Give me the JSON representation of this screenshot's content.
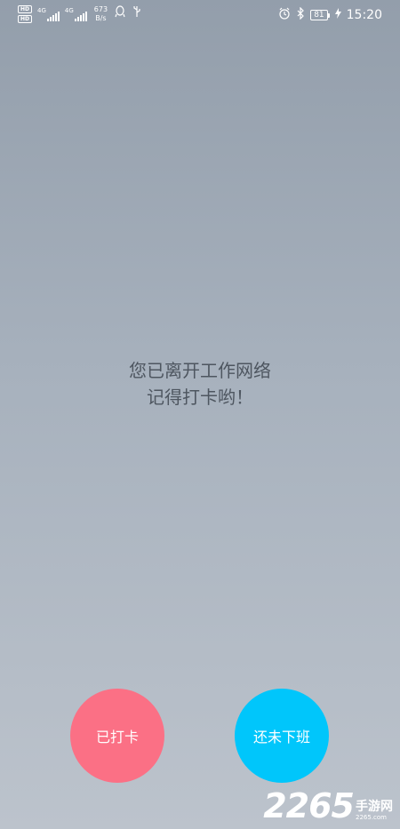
{
  "status_bar": {
    "hd_badges": [
      "HD",
      "HD"
    ],
    "network_1": "4G",
    "network_2": "4G",
    "speed_value": "673",
    "speed_unit": "B/s",
    "battery_level": "81",
    "time": "15:20",
    "icons": [
      "qq-icon",
      "usb-icon",
      "alarm-icon",
      "bluetooth-icon",
      "charging-icon"
    ]
  },
  "message": {
    "line1": "您已离开工作网络",
    "line2": "记得打卡哟！"
  },
  "buttons": {
    "clocked_in": {
      "label": "已打卡",
      "color": "#fb7085"
    },
    "not_off_work": {
      "label": "还未下班",
      "color": "#00c6fb"
    }
  },
  "watermark": {
    "number": "2265",
    "text": "手游网",
    "domain": "2265.com"
  }
}
